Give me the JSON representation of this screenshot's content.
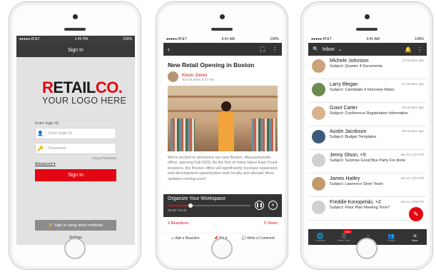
{
  "phone1": {
    "status": {
      "carrier": "●●●●● AT&T",
      "time": "1:45 PM",
      "battery": "100%"
    },
    "header_title": "Sign In",
    "logo": {
      "brand_main": "RETAIL",
      "brand_suffix": "CO.",
      "tagline": "YOUR LOGO HERE"
    },
    "login_label": "Enter login ID",
    "login_placeholder": "Enter login ID",
    "password_placeholder": "Password",
    "forgot": "Forgot Password",
    "advanced": "Advanced ▾",
    "signin": "Sign In",
    "other_methods": "🔒 Sign in using other methods",
    "settings": "Settings",
    "icons": {
      "user": "user-icon",
      "key": "key-icon"
    }
  },
  "phone2": {
    "status": {
      "carrier": "●●●●● AT&T",
      "time": "9:41 AM",
      "battery": "100%"
    },
    "title": "New Retail Opening in Boston",
    "author": "Kevin Jones",
    "date": "Nov 05 2018, 6:57 PM",
    "body": "We're excited to announce our new Boston, Massachusetts office, opening Fall 2020. As the first of many future East Coast locations, the Boston office will significantly increase expansion and development opportunities both locally and abroad. More updates coming soon!",
    "media": {
      "title": "Organize Your Workspace",
      "time": "00:26 / 01:32",
      "progress": 0.28
    },
    "reactions": "2 Reactions",
    "views": "5 Views",
    "actions": {
      "reaction": "Add a Reaction",
      "pin": "Pin it",
      "comment": "Write a Comment"
    }
  },
  "phone3": {
    "status": {
      "carrier": "●●●●● AT&T",
      "time": "9:41 AM",
      "battery": "100%"
    },
    "header_title": "Inbox",
    "messages": [
      {
        "from": "Michele Johnston",
        "subject": "Subject: Quarter 4 Documents",
        "when": "13 minutes ago",
        "color": "#c9a27a"
      },
      {
        "from": "Larry Blegan",
        "subject": "Subject: Candidate 4 Interview Notes",
        "when": "17 minutes ago",
        "color": "#6b8a4f"
      },
      {
        "from": "Grant Carter",
        "subject": "Subject: Conference Registration Information",
        "when": "23 minutes ago",
        "color": "#d9b38c"
      },
      {
        "from": "Austin Jacobson",
        "subject": "Subject: Budget Templates",
        "when": "56 minutes ago",
        "color": "#3d5a7a"
      },
      {
        "from": "Jenny Olson, +5",
        "subject": "Subject: Surprise Good Bye Party For Anne",
        "when": "Jan 24, 8:34 PM",
        "color": "#d0d0d0"
      },
      {
        "from": "James Hatley",
        "subject": "Subject: Lawrence Store Team",
        "when": "Jan 24, 9:02 PM",
        "color": "#c49a6c"
      },
      {
        "from": "Freddie Konopelski, +2",
        "subject": "Subject: Floor Plan Meeting Time?",
        "when": "Jan 24, 9:35 PM",
        "color": "#d0d0d0"
      }
    ],
    "tabs": [
      {
        "label": "Company",
        "icon": "🌐"
      },
      {
        "label": "News Feed",
        "icon": "☰",
        "badge": "New"
      },
      {
        "label": "Dashboards",
        "icon": "◔"
      },
      {
        "label": "Groups",
        "icon": "👥"
      },
      {
        "label": "More",
        "icon": "≡"
      }
    ]
  }
}
